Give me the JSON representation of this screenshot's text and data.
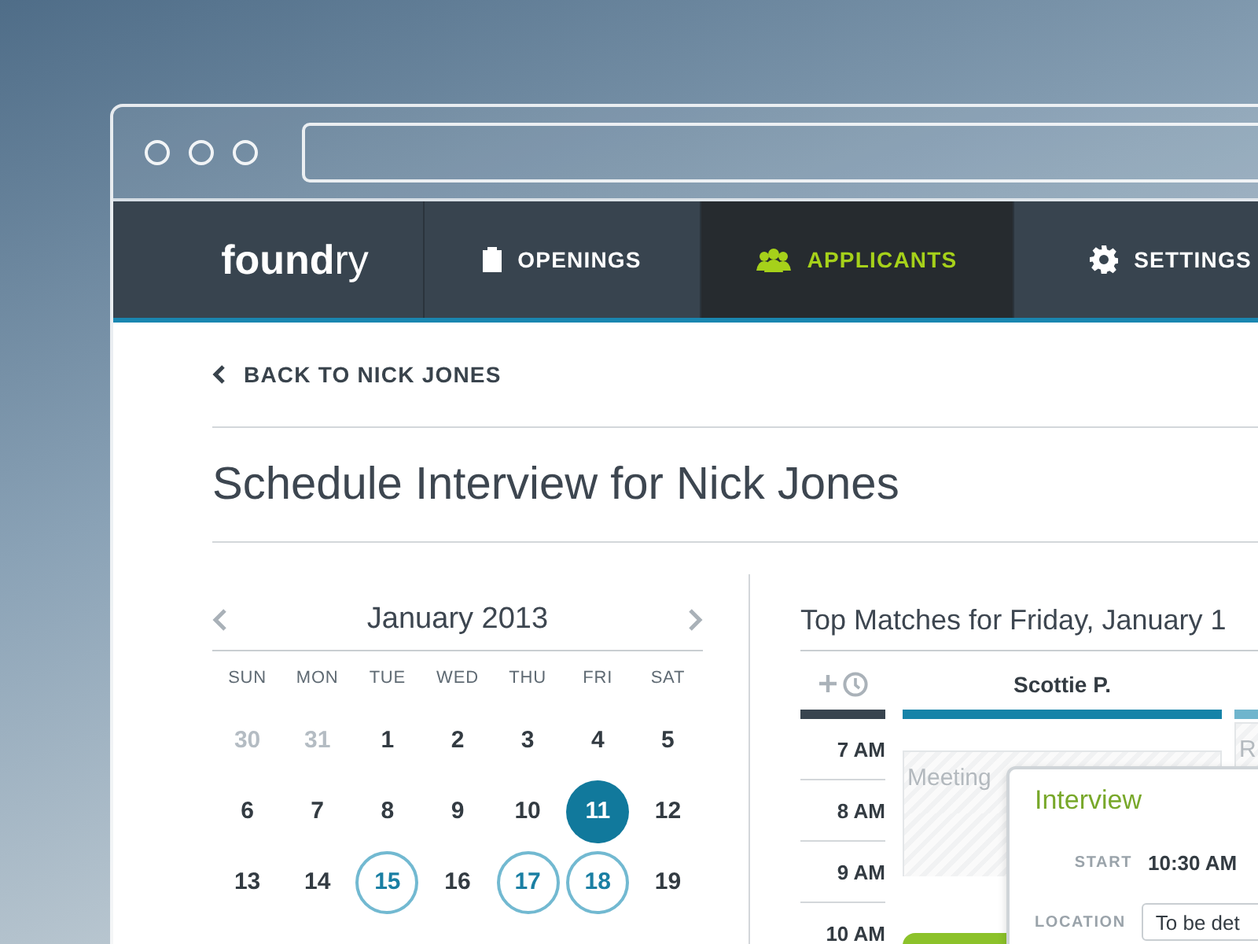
{
  "nav": {
    "logo": {
      "bold": "found",
      "light": "ry"
    },
    "items": [
      {
        "label": "OPENINGS",
        "selected": false
      },
      {
        "label": "APPLICANTS",
        "selected": true
      },
      {
        "label": "SETTINGS",
        "selected": false
      }
    ]
  },
  "back_link": "BACK TO NICK JONES",
  "title": "Schedule Interview for Nick Jones",
  "calendar": {
    "month": "January 2013",
    "weekdays": [
      "SUN",
      "MON",
      "TUE",
      "WED",
      "THU",
      "FRI",
      "SAT"
    ],
    "weeks": [
      [
        {
          "day": "30",
          "outside": true,
          "selected": false,
          "highlighted": false
        },
        {
          "day": "31",
          "outside": true,
          "selected": false,
          "highlighted": false
        },
        {
          "day": "1",
          "outside": false,
          "selected": false,
          "highlighted": false
        },
        {
          "day": "2",
          "outside": false,
          "selected": false,
          "highlighted": false
        },
        {
          "day": "3",
          "outside": false,
          "selected": false,
          "highlighted": false
        },
        {
          "day": "4",
          "outside": false,
          "selected": false,
          "highlighted": false
        },
        {
          "day": "5",
          "outside": false,
          "selected": false,
          "highlighted": false
        }
      ],
      [
        {
          "day": "6",
          "outside": false,
          "selected": false,
          "highlighted": false
        },
        {
          "day": "7",
          "outside": false,
          "selected": false,
          "highlighted": false
        },
        {
          "day": "8",
          "outside": false,
          "selected": false,
          "highlighted": false
        },
        {
          "day": "9",
          "outside": false,
          "selected": false,
          "highlighted": false
        },
        {
          "day": "10",
          "outside": false,
          "selected": false,
          "highlighted": false
        },
        {
          "day": "11",
          "outside": false,
          "selected": true,
          "highlighted": false
        },
        {
          "day": "12",
          "outside": false,
          "selected": false,
          "highlighted": false
        }
      ],
      [
        {
          "day": "13",
          "outside": false,
          "selected": false,
          "highlighted": false
        },
        {
          "day": "14",
          "outside": false,
          "selected": false,
          "highlighted": false
        },
        {
          "day": "15",
          "outside": false,
          "selected": false,
          "highlighted": true
        },
        {
          "day": "16",
          "outside": false,
          "selected": false,
          "highlighted": false
        },
        {
          "day": "17",
          "outside": false,
          "selected": false,
          "highlighted": true
        },
        {
          "day": "18",
          "outside": false,
          "selected": false,
          "highlighted": true
        },
        {
          "day": "19",
          "outside": false,
          "selected": false,
          "highlighted": false
        }
      ]
    ]
  },
  "schedule": {
    "title": "Top Matches for Friday, January 1",
    "hours": [
      "7 AM",
      "8 AM",
      "9 AM",
      "10 AM"
    ],
    "columns": [
      {
        "name": "Scottie P.",
        "color": "#1583a8",
        "slots": [
          {
            "kind": "busy",
            "label": "Meeting"
          },
          {
            "kind": "busy"
          },
          {
            "kind": "open"
          },
          {
            "kind": "booked"
          }
        ]
      },
      {
        "color": "#6fb5cd",
        "slots": [
          {
            "kind": "busy",
            "label": "R"
          }
        ]
      }
    ],
    "popup": {
      "title": "Interview",
      "fields": [
        {
          "kind": "text",
          "label": "START",
          "value": "10:30 AM"
        },
        {
          "kind": "input",
          "label": "LOCATION",
          "value": "To be det"
        }
      ]
    }
  }
}
